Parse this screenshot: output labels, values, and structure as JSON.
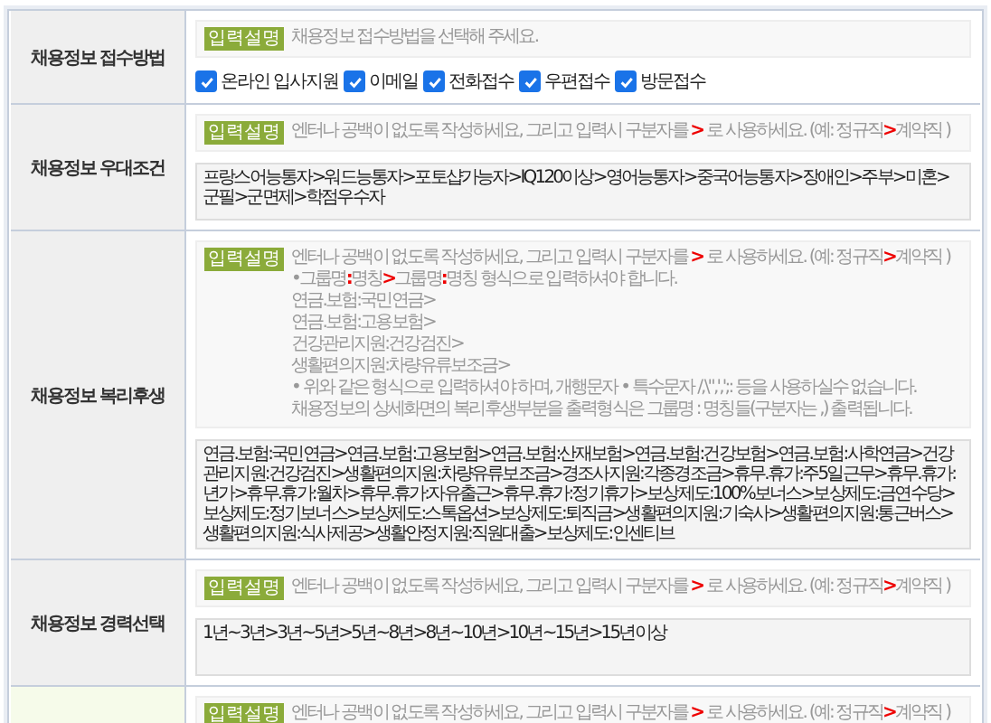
{
  "rows": [
    {
      "label": "채용정보 접수방법",
      "kind": "checkboxes",
      "badge": "입력설명",
      "hint_lines": [
        [
          {
            "text": "채용정보 접수방법을 선택해 주세요.",
            "emphasis": false
          }
        ]
      ],
      "options": [
        {
          "label": "온라인 입사지원",
          "checked": true
        },
        {
          "label": "이메일",
          "checked": true
        },
        {
          "label": "전화접수",
          "checked": true
        },
        {
          "label": "우편접수",
          "checked": true
        },
        {
          "label": "방문접수",
          "checked": true
        }
      ]
    },
    {
      "label": "채용정보 우대조건",
      "kind": "textarea",
      "badge": "입력설명",
      "hint_lines": [
        [
          {
            "text": "엔터나 공백이 없도록 작성하세요, 그리고 입력시 구분자를 ",
            "emphasis": false
          },
          {
            "text": ">",
            "emphasis": true
          },
          {
            "text": " 로 사용하세요. (예: 정규직",
            "emphasis": false
          },
          {
            "text": ">",
            "emphasis": true
          },
          {
            "text": "계약직 )",
            "emphasis": false
          }
        ]
      ],
      "value": "프랑스어능통자>워드능통자>포토샵가능자>IQ120이상>영어능통자>중국어능통자>장애인>주부>미혼>군필>군면제>학점우수자"
    },
    {
      "label": "채용정보 복리후생",
      "kind": "textarea",
      "badge": "입력설명",
      "hint_lines": [
        [
          {
            "text": "엔터나 공백이 없도록 작성하세요, 그리고 입력시 구분자를 ",
            "emphasis": false
          },
          {
            "text": ">",
            "emphasis": true
          },
          {
            "text": " 로 사용하세요. (예: 정규직",
            "emphasis": false
          },
          {
            "text": ">",
            "emphasis": true
          },
          {
            "text": "계약직 )",
            "emphasis": false
          }
        ],
        [
          {
            "text": "•그룹명",
            "emphasis": false
          },
          {
            "text": ":",
            "emphasis": true
          },
          {
            "text": "명칭",
            "emphasis": false
          },
          {
            "text": ">",
            "emphasis": true
          },
          {
            "text": "그룹명",
            "emphasis": false
          },
          {
            "text": ":",
            "emphasis": true
          },
          {
            "text": "명칭 형식으로 입력하셔야 합니다.",
            "emphasis": false
          }
        ],
        [
          {
            "text": "연금.보험:국민연금>",
            "emphasis": false
          }
        ],
        [
          {
            "text": "연금.보험:고용보험>",
            "emphasis": false
          }
        ],
        [
          {
            "text": "건강관리지원:건강검진>",
            "emphasis": false
          }
        ],
        [
          {
            "text": "생활편의지원:차량유류보조금>",
            "emphasis": false
          }
        ],
        [
          {
            "text": "• 위와 같은 형식으로 입력하셔야 하며, 개행문자 • 특수문자 /,\\\",',';: 등을 사용하실수 없습니다.",
            "emphasis": false
          }
        ],
        [
          {
            "text": "채용정보의 상세화면의 복리후생부분을 출력형식은 그룹명 : 명칭들(구분자는 ,) 출력됩니다.",
            "emphasis": false
          }
        ]
      ],
      "value": "연금.보험:국민연금>연금.보험:고용보험>연금.보험:산재보험>연금.보험:건강보험>연금.보험:사학연금>건강관리지원:건강검진>생활편의지원:차량유류보조금>경조사지원:각종경조금>휴무.휴가:주5일근무>휴무.휴가:년가>휴무.휴가:월차>휴무.휴가:자유출근>휴무.휴가:정기휴가>보상제도:100%보너스>보상제도:금연수당>보상제도:정기보너스>보상제도:스톡옵션>보상제도:퇴직금>생활편의지원:기숙사>생활편의지원:통근버스>생활편의지원:식사제공>생활안정지원:직원대출>보상제도:인센티브"
    },
    {
      "label": "채용정보 경력선택",
      "kind": "textarea",
      "badge": "입력설명",
      "hint_lines": [
        [
          {
            "text": "엔터나 공백이 없도록 작성하세요, 그리고 입력시 구분자를 ",
            "emphasis": false
          },
          {
            "text": ">",
            "emphasis": true
          },
          {
            "text": " 로 사용하세요. (예: 정규직",
            "emphasis": false
          },
          {
            "text": ">",
            "emphasis": true
          },
          {
            "text": "계약직 )",
            "emphasis": false
          }
        ]
      ],
      "value": "1년~3년>3년~5년>5년~8년>8년~10년>10년~15년>15년이상"
    },
    {
      "kind": "textarea",
      "badge": "입력설명",
      "hint_lines": [
        [
          {
            "text": "엔터나 공백이 없도록 작성하세요, 그리고 입력시 구분자를 ",
            "emphasis": false
          },
          {
            "text": ">",
            "emphasis": true
          },
          {
            "text": " 로 사용하세요. (예: 정규직",
            "emphasis": false
          },
          {
            "text": ">",
            "emphasis": true
          },
          {
            "text": "계약직 )",
            "emphasis": false
          }
        ]
      ]
    }
  ]
}
